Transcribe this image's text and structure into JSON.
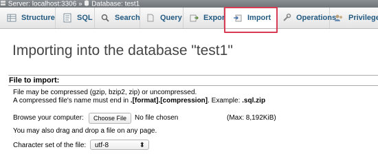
{
  "breadcrumb": {
    "server": "Server: localhost:3306",
    "separator": "»",
    "database": "Database: test1"
  },
  "tabs": [
    {
      "label": "Structure",
      "icon": "structure-icon",
      "active": false
    },
    {
      "label": "SQL",
      "icon": "sql-icon",
      "active": false
    },
    {
      "label": "Search",
      "icon": "search-icon",
      "active": false
    },
    {
      "label": "Query",
      "icon": "query-icon",
      "active": false
    },
    {
      "label": "Export",
      "icon": "export-icon",
      "active": false
    },
    {
      "label": "Import",
      "icon": "import-icon",
      "active": true
    },
    {
      "label": "Operations",
      "icon": "operations-icon",
      "active": false
    },
    {
      "label": "Privileges",
      "icon": "privileges-icon",
      "active": false
    }
  ],
  "page": {
    "title": "Importing into the database \"test1\""
  },
  "file_section": {
    "heading": "File to import:",
    "compression_line": "File may be compressed (gzip, bzip2, zip) or uncompressed.",
    "name_prefix": "A compressed file's name must end in ",
    "name_format": ".[format].[compression]",
    "example_prefix": ". Example: ",
    "example": ".sql.zip",
    "browse_label": "Browse your computer:",
    "choose_button": "Choose File",
    "no_file": "No file chosen",
    "max_size": "(Max: 8,192KiB)",
    "drag_drop": "You may also drag and drop a file on any page.",
    "charset_label": "Character set of the file:",
    "charset_value": "utf-8"
  },
  "colors": {
    "tab_text": "#235a81",
    "highlight": "#d83a52"
  }
}
